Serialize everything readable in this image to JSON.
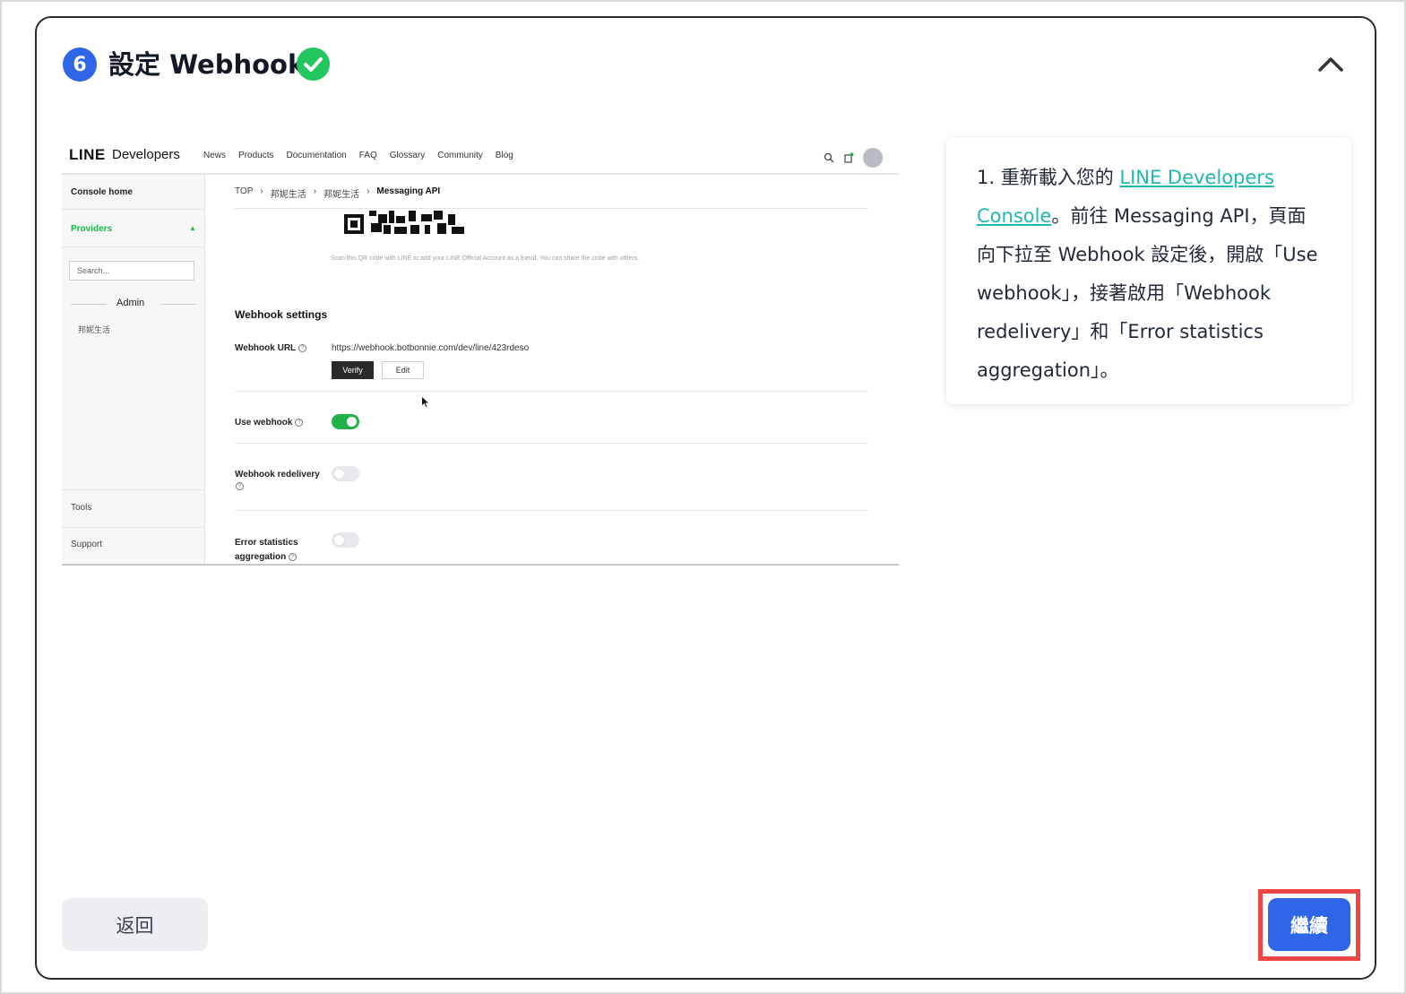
{
  "header": {
    "step_number": "6",
    "title": "設定 Webhook",
    "check_icon": "check-circle-icon",
    "collapse_icon": "chevron-up-icon"
  },
  "screenshot": {
    "logo": "LINE",
    "logo_sub": "Developers",
    "nav": [
      "News",
      "Products",
      "Documentation",
      "FAQ",
      "Glossary",
      "Community",
      "Blog"
    ],
    "sidebar": {
      "console_home": "Console home",
      "providers": "Providers",
      "search_placeholder": "Search...",
      "admin": "Admin",
      "provider_item": "邦妮生活",
      "tools": "Tools",
      "support": "Support"
    },
    "breadcrumb": [
      "TOP",
      "邦妮生活",
      "邦妮生活",
      "Messaging API"
    ],
    "qr_caption": "Scan this QR code with LINE to add your LINE Official Account as a friend. You can share the code with others.",
    "section_title": "Webhook settings",
    "webhook_url_label": "Webhook URL",
    "webhook_url_value": "https://webhook.botbonnie.com/dev/line/423rdeso",
    "verify_label": "Verify",
    "edit_label": "Edit",
    "use_webhook_label": "Use webhook",
    "use_webhook_on": true,
    "redelivery_label": "Webhook redelivery",
    "redelivery_on": false,
    "error_stats_label_1": "Error statistics",
    "error_stats_label_2": "aggregation",
    "error_stats_on": false
  },
  "instructions": {
    "prefix": "1. 重新載入您的 ",
    "link_text": "LINE Developers Console",
    "suffix": "。前往 Messaging API，頁面向下拉至 Webhook 設定後，開啟「Use webhook」，接著啟用「Webhook redelivery」和「Error statistics aggregation」。",
    "link_color": "#1fb8b2"
  },
  "buttons": {
    "back_label": "返回",
    "continue_label": "繼續"
  },
  "colors": {
    "primary": "#2f66e8",
    "success": "#22c55e",
    "highlight": "#ef4444"
  }
}
